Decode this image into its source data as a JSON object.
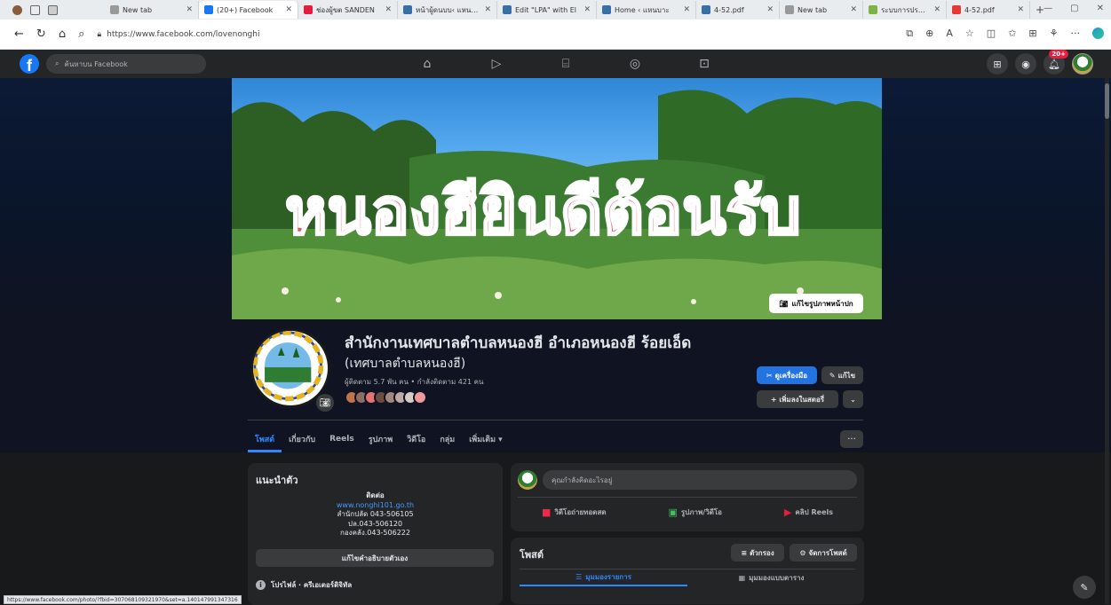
{
  "browser": {
    "tabs": [
      {
        "title": "New tab",
        "color": "#999999",
        "width": 106
      },
      {
        "title": "(20+) Facebook",
        "color": "#1877f2",
        "width": 112,
        "active": true
      },
      {
        "title": "ช่องผู้ขต SANDEN",
        "color": "#e41e3f",
        "width": 112
      },
      {
        "title": "หน้าผู้ดนบบ‹ แหนบาะ",
        "color": "#3a6ea5",
        "width": 112
      },
      {
        "title": "Edit \"LPA\" with El",
        "color": "#3a6ea5",
        "width": 112
      },
      {
        "title": "Home ‹ แหนบาะ",
        "color": "#3a6ea5",
        "width": 112
      },
      {
        "title": "4-52.pdf",
        "color": "#3a6ea5",
        "width": 94
      },
      {
        "title": "New tab",
        "color": "#999999",
        "width": 94
      },
      {
        "title": "ระบบการประเมินประ",
        "color": "#7cb342",
        "width": 94
      },
      {
        "title": "4-52.pdf",
        "color": "#e53935",
        "width": 94
      }
    ],
    "new_tab": "+",
    "url": "https://www.facebook.com/lovenonghi",
    "status_url": "https://www.facebook.com/photo/?fbid=307068109321970&set=a.140147991347316"
  },
  "fbnav": {
    "logo": "f",
    "search_placeholder": "ค้นหาบน Facebook",
    "notif_count": "20+"
  },
  "cover": {
    "sign_text": "หนองฮียินดีต้อนรับ",
    "edit_cover": "แก้ไขรูปภาพหน้าปก"
  },
  "page": {
    "name": "สำนักงานเทศบาลตำบลหนองฮี อำเภอหนองฮี ร้อยเอ็ด",
    "alt_name": "(เทศบาลตำบลหนองฮี)",
    "follow_line": "ผู้ติดตาม 5.7 พัน คน • กำลังติดตาม 421 คน",
    "btn_tools": "ดูเครื่องมือ",
    "btn_edit": "แก้ไข",
    "btn_add_story": "+ เพิ่มลงในสตอรี่",
    "btn_more": "⌄",
    "tabs": [
      "โพสต์",
      "เกี่ยวกับ",
      "Reels",
      "รูปภาพ",
      "วิดีโอ",
      "กลุ่ม",
      "เพิ่มเติม ▾"
    ],
    "tabs_more": "···"
  },
  "intro": {
    "title": "แนะนำตัว",
    "contact_label": "ติดต่อ",
    "website": "www.nonghi101.go.th",
    "line1": "สำนักปลัด 043-506105",
    "line2": "ปล.043-506120",
    "line3": "กองคลัง.043-506222",
    "edit_bio": "แก้ไขคำอธิบายตัวเอง",
    "profile_row": "โปรไฟล์ · ครีเอเตอร์ดิจิทัล"
  },
  "composer": {
    "placeholder": "คุณกำลังคิดอะไรอยู่",
    "live": "วิดีโอถ่ายทอดสด",
    "photo": "รูปภาพ/วิดีโอ",
    "reels": "คลิป Reels"
  },
  "posts": {
    "title": "โพสต์",
    "filter": "ตัวกรอง",
    "manage": "จัดการโพสต์",
    "list_view": "มุมมองรายการ",
    "grid_view": "มุมมองแบบตาราง"
  },
  "colors": {
    "accent": "#2374e1",
    "live_red": "#f02849",
    "photo_green": "#45bd62",
    "reels_red": "#e41e3f"
  }
}
